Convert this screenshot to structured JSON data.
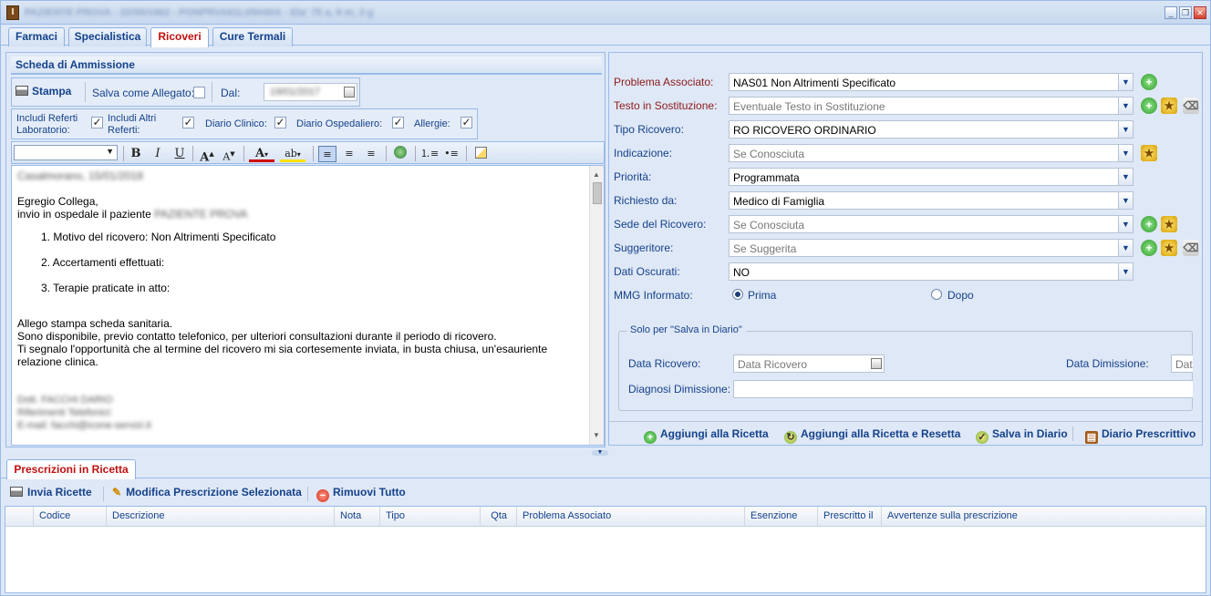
{
  "window": {
    "title": "PAZIENTE PROVA - 32/05/1962 - PONPRVA61L05H40A - Eta' 75 a, 8 m, 3 g",
    "controls": [
      "_",
      "❐",
      "✕"
    ]
  },
  "tabs": [
    "Farmaci",
    "Specialistica",
    "Ricoveri",
    "Cure Termali"
  ],
  "active_tab": "Ricoveri",
  "left": {
    "section_title": "Scheda di Ammissione",
    "stampa_label": "Stampa",
    "salva_allegato_label": "Salva come Allegato:",
    "dal_label": "Dal:",
    "dal_value": "19/01/2017",
    "includes": [
      {
        "label": "Includi Referti Laboratorio:",
        "checked": true
      },
      {
        "label": "Includi Altri Referti:",
        "checked": true
      },
      {
        "label": "Diario Clinico:",
        "checked": true
      },
      {
        "label": "Diario Ospedaliero:",
        "checked": true
      },
      {
        "label": "Allergie:",
        "checked": true
      }
    ],
    "editor": {
      "place_date": "Casalmorano, 15/01/2018",
      "greeting": "Egregio Collega,",
      "intro": "invio in ospedale il paziente",
      "patient_name": "PAZIENTE PROVA",
      "items": [
        "1. Motivo del ricovero: Non Altrimenti Specificato",
        "2. Accertamenti effettuati:",
        "3. Terapie praticate in atto:"
      ],
      "para1": "Allego stampa scheda sanitaria.",
      "para2": "Sono disponibile, previo contatto telefonico, per ulteriori consultazioni durante il periodo di ricovero.",
      "para3": "Ti segnalo l'opportunità che al termine del ricovero mi sia cortesemente inviata, in busta chiusa, un'esauriente",
      "para4": "relazione clinica.",
      "sig1": "Dott. FACCHI DARIO",
      "sig2": "Riferimenti Telefonici:",
      "sig3": "E-mail: facchi@icone-servizi.it"
    }
  },
  "right": {
    "fields": [
      {
        "label": "Problema Associato:",
        "value": "NAS01 Non Altrimenti Specificato",
        "placeholder": false,
        "required": true
      },
      {
        "label": "Testo in Sostituzione:",
        "value": "Eventuale Testo in Sostituzione",
        "placeholder": true,
        "required": true
      },
      {
        "label": "Tipo Ricovero:",
        "value": "RO RICOVERO ORDINARIO",
        "placeholder": false,
        "required": false
      },
      {
        "label": "Indicazione:",
        "value": "Se Conosciuta",
        "placeholder": true,
        "required": false
      },
      {
        "label": "Priorità:",
        "value": "Programmata",
        "placeholder": false,
        "required": false
      },
      {
        "label": "Richiesto da:",
        "value": "Medico di Famiglia",
        "placeholder": false,
        "required": false
      },
      {
        "label": "Sede del Ricovero:",
        "value": "Se Conosciuta",
        "placeholder": true,
        "required": false
      },
      {
        "label": "Suggeritore:",
        "value": "Se Suggerita",
        "placeholder": true,
        "required": false
      },
      {
        "label": "Dati Oscurati:",
        "value": "NO",
        "placeholder": false,
        "required": false
      }
    ],
    "mmg_label": "MMG Informato:",
    "mmg_options": [
      "Prima",
      "Dopo"
    ],
    "mmg_selected": "Prima",
    "fieldset_legend": "Solo per \"Salva in Diario\"",
    "data_ricovero_label": "Data Ricovero:",
    "data_ricovero_placeholder": "Data Ricovero",
    "data_dimissione_label": "Data Dimissione:",
    "data_dimissione_placeholder": "Data",
    "diagnosi_label": "Diagnosi Dimissione:",
    "footer_buttons": [
      "Aggiungi alla Ricetta",
      "Aggiungi alla Ricetta e Resetta",
      "Salva in Diario",
      "Diario Prescrittivo"
    ]
  },
  "bottom": {
    "tab": "Prescrizioni in Ricetta",
    "toolbar": [
      "Invia Ricette",
      "Modifica Prescrizione Selezionata",
      "Rimuovi Tutto"
    ],
    "columns": [
      "Codice",
      "Descrizione",
      "Nota",
      "Tipo",
      "Qta",
      "Problema Associato",
      "Esenzione",
      "Prescritto il",
      "Avvertenze sulla prescrizione"
    ]
  },
  "colors": {
    "accent": "#15428b",
    "active_tab": "#c01010",
    "panel_bg": "#dfe8f6",
    "border": "#99bbe8"
  }
}
